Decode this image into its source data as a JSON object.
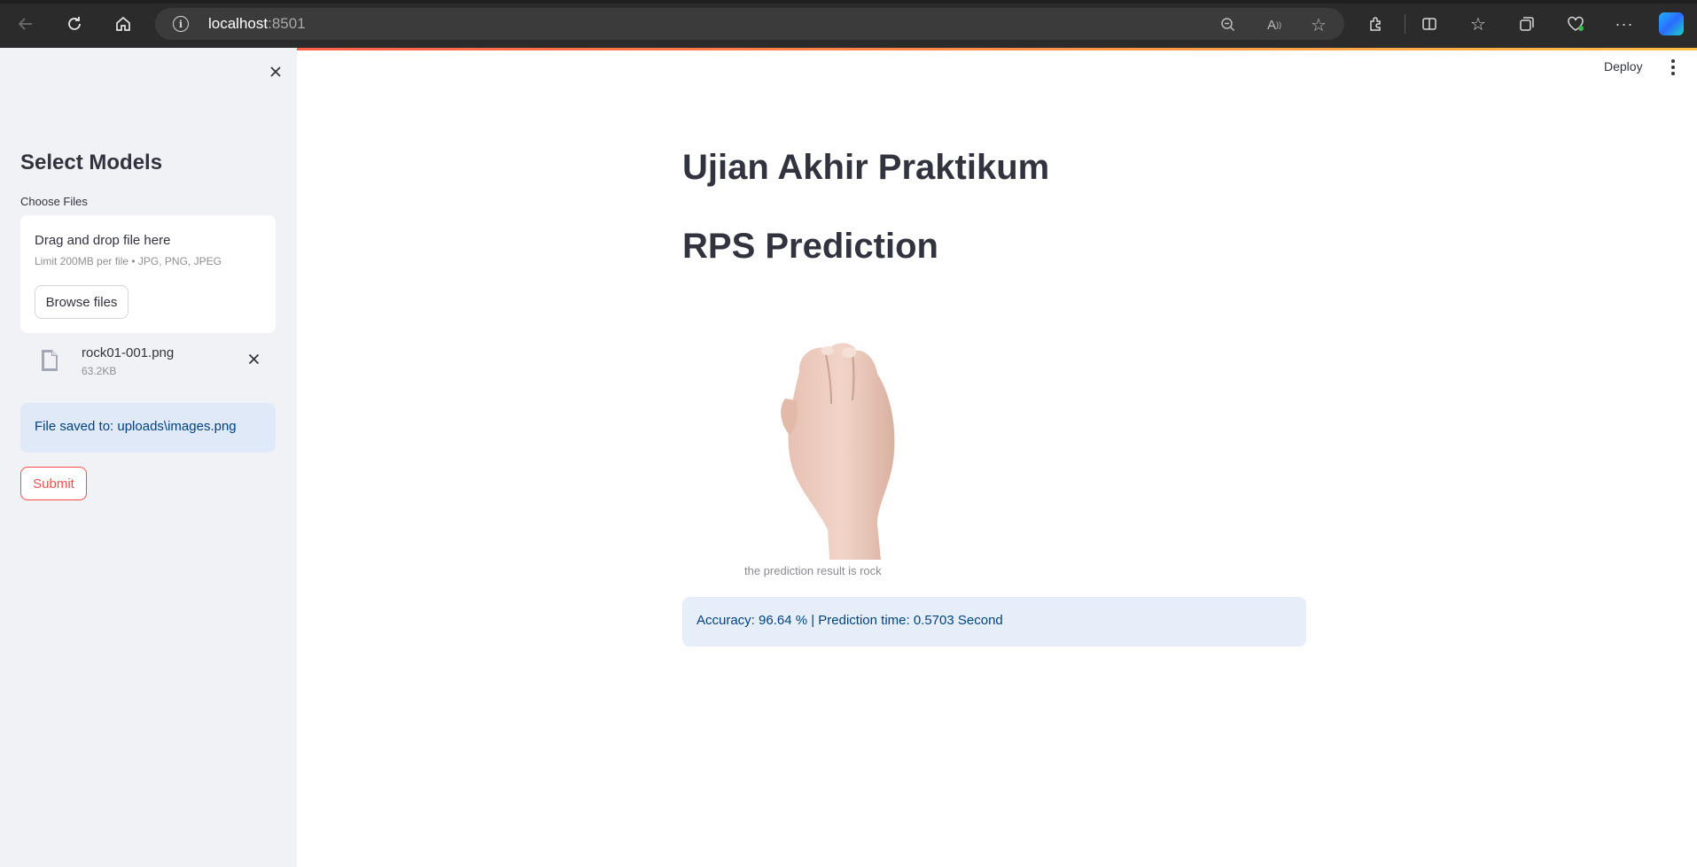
{
  "browser": {
    "url_host": "localhost",
    "url_port": ":8501",
    "icons": [
      "back-icon",
      "reload-icon",
      "home-icon",
      "info-icon",
      "zoom-out-icon",
      "read-aloud-icon",
      "favorite-star-icon",
      "extensions-icon",
      "split-screen-icon",
      "favorites-icon",
      "collections-icon",
      "browser-essentials-icon",
      "more-icon",
      "copilot-icon"
    ]
  },
  "header": {
    "deploy_label": "Deploy"
  },
  "sidebar": {
    "title": "Select Models",
    "uploader_label": "Choose Files",
    "dropzone_title": "Drag and drop file here",
    "dropzone_limit": "Limit 200MB per file • JPG, PNG, JPEG",
    "browse_label": "Browse files",
    "file": {
      "name": "rock01-001.png",
      "size": "63.2KB"
    },
    "saved_message": "File saved to: uploads\\images.png",
    "submit_label": "Submit"
  },
  "main": {
    "title": "Ujian Akhir Praktikum",
    "subtitle": "RPS Prediction",
    "image_caption": "the prediction result is rock",
    "result_message": "Accuracy: 96.64 % | Prediction time: 0.5703 Second"
  }
}
